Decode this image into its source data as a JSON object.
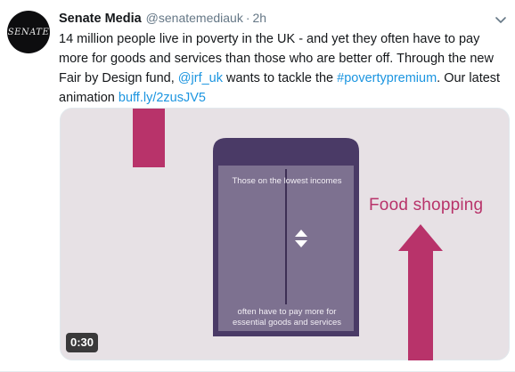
{
  "tweet": {
    "author_name": "Senate Media",
    "author_handle": "@senatemediauk",
    "separator": "·",
    "timestamp": "2h",
    "avatar_text": "SENATE",
    "text_part1": "14 million people live in poverty in the UK - and yet they often have to pay more for goods and services than those who are better off. Through the new Fair by Design fund, ",
    "mention": "@jrf_uk",
    "text_part2": " wants to tackle the ",
    "hashtag": "#povertypremium",
    "text_part3": ". Our latest animation ",
    "link": "buff.ly/2zusJV5"
  },
  "video": {
    "panel_top_text": "Those on the lowest incomes",
    "panel_bottom_line1": "often have to pay more for",
    "panel_bottom_line2": "essential goods and services",
    "side_label": "Food shopping",
    "duration": "0:30"
  },
  "icons": {
    "caret": "chevron-down-icon",
    "arrows": "up-down-arrows-icon",
    "up_arrow": "up-arrow-icon"
  },
  "colors": {
    "link": "#1b95e0",
    "accent_pink": "#b8336a",
    "panel_purple": "#4a3a66",
    "video_bg": "#e7e1e5"
  }
}
